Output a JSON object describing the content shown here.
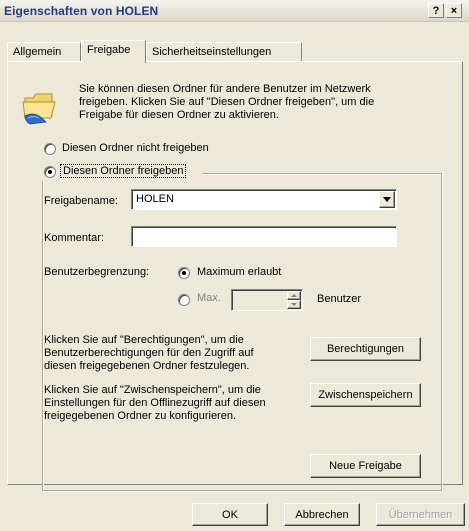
{
  "window": {
    "title": "Eigenschaften von HOLEN",
    "help_label": "?",
    "close_label": "×"
  },
  "tabs": [
    {
      "label": "Allgemein"
    },
    {
      "label": "Freigabe"
    },
    {
      "label": "Sicherheitseinstellungen"
    }
  ],
  "intro": {
    "line1": "Sie können diesen Ordner für andere Benutzer im Netzwerk",
    "line2": "freigeben. Klicken Sie auf \"Diesen Ordner freigeben\", um die",
    "line3": "Freigabe für diesen Ordner zu aktivieren."
  },
  "share": {
    "option_off": "Diesen Ordner nicht freigeben",
    "option_on": "Diesen Ordner freigeben",
    "selected": "Diesen Ordner freigeben"
  },
  "form": {
    "share_name_label": "Freigabename:",
    "share_name_value": "HOLEN",
    "comment_label": "Kommentar:",
    "comment_value": "",
    "user_limit_label": "Benutzerbegrenzung:",
    "limit_max_allowed": "Maximum erlaubt",
    "limit_max": "Max.",
    "limit_value": "",
    "limit_unit": "Benutzer"
  },
  "permissions": {
    "line1": "Klicken Sie auf \"Berechtigungen\", um die",
    "line2": "Benutzerberechtigungen für den Zugriff auf",
    "line3": "diesen freigegebenen Ordner festzulegen.",
    "button": "Berechtigungen"
  },
  "caching": {
    "line1": "Klicken Sie auf \"Zwischenspeichern\", um die",
    "line2": "Einstellungen für den Offlinezugriff auf diesen",
    "line3": "freigegebenen Ordner zu konfigurieren.",
    "button": "Zwischenspeichern"
  },
  "new_share_button": "Neue Freigabe",
  "footer": {
    "ok": "OK",
    "cancel": "Abbrechen",
    "apply": "Übernehmen"
  }
}
